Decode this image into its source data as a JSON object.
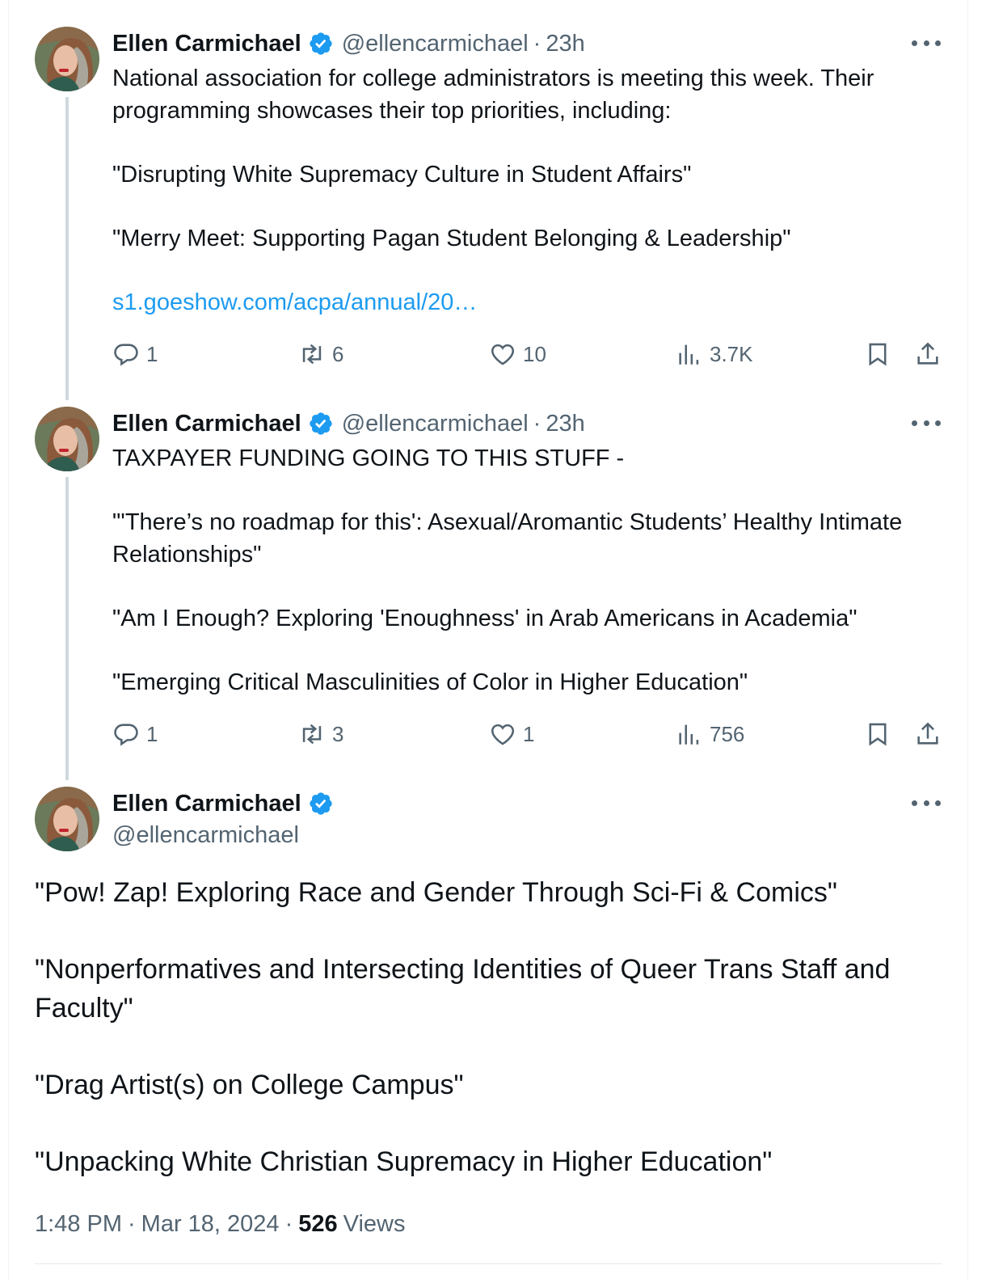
{
  "colors": {
    "accent": "#1d9bf0",
    "secondary": "#536471",
    "text": "#0f1419",
    "verified": "#1d9bf0",
    "thread_line": "#cfd9de"
  },
  "tweets": [
    {
      "name": "Ellen Carmichael",
      "handle": "@ellencarmichael",
      "dot": "·",
      "time": "23h",
      "paragraphs": [
        "National association for college administrators is meeting this week. Their programming showcases their top priorities, including:",
        "\"Disrupting White Supremacy Culture in Student Affairs\"",
        "\"Merry Meet: Supporting Pagan Student Belonging & Leadership\""
      ],
      "link": "s1.goeshow.com/acpa/annual/20…",
      "stats": {
        "replies": "1",
        "reposts": "6",
        "likes": "10",
        "views": "3.7K"
      }
    },
    {
      "name": "Ellen Carmichael",
      "handle": "@ellencarmichael",
      "dot": "·",
      "time": "23h",
      "paragraphs": [
        "TAXPAYER FUNDING GOING TO THIS STUFF -",
        "\"'There’s no roadmap for this': Asexual/Aromantic Students’ Healthy Intimate Relationships\"",
        "\"Am I Enough? Exploring 'Enoughness' in Arab Americans in Academia\"",
        "\"Emerging Critical Masculinities of Color in Higher Education\""
      ],
      "stats": {
        "replies": "1",
        "reposts": "3",
        "likes": "1",
        "views": "756"
      }
    },
    {
      "name": "Ellen Carmichael",
      "handle": "@ellencarmichael",
      "paragraphs": [
        "\"Pow! Zap! Exploring Race and Gender Through Sci-Fi & Comics\"",
        "\"Nonperformatives and Intersecting Identities of Queer Trans Staff and Faculty\"",
        "\"Drag Artist(s) on College Campus\"",
        "\"Unpacking White Christian Supremacy in Higher Education\""
      ],
      "meta": {
        "time": "1:48 PM",
        "sep1": "·",
        "date": "Mar 18, 2024",
        "sep2": "·",
        "views_count": "526",
        "views_label": "Views"
      }
    }
  ],
  "icons": [
    "verified-badge-icon",
    "more-icon",
    "reply-icon",
    "repost-icon",
    "like-icon",
    "views-icon",
    "bookmark-icon",
    "share-icon"
  ]
}
